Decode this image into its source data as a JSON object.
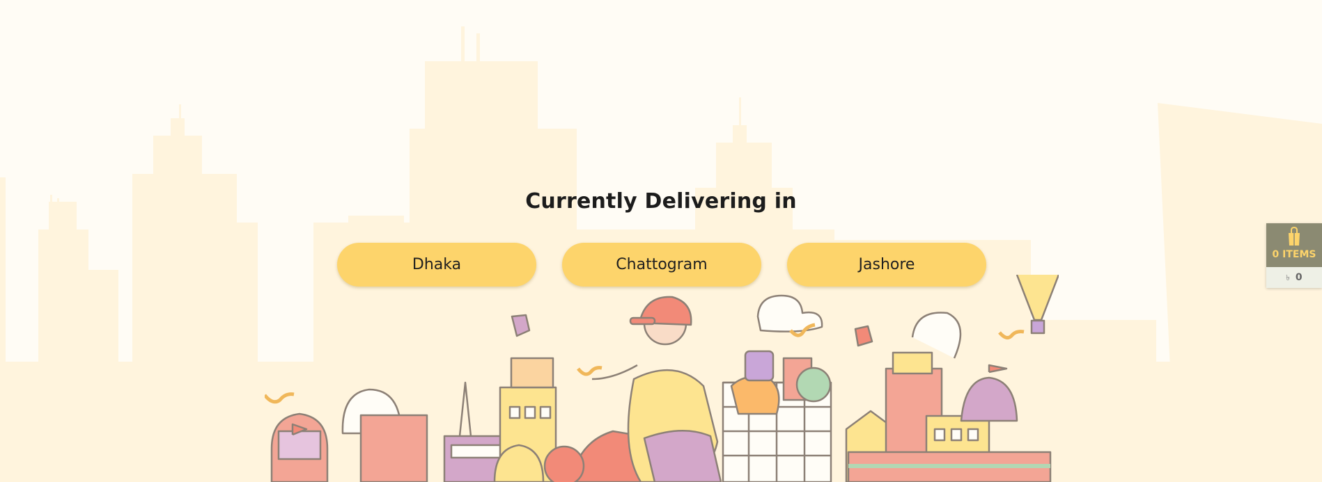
{
  "heading": "Currently Delivering in",
  "cities": [
    {
      "label": "Dhaka"
    },
    {
      "label": "Chattogram"
    },
    {
      "label": "Jashore"
    }
  ],
  "cart": {
    "items_label": "0 ITEMS",
    "currency": "৳",
    "amount": "0"
  },
  "colors": {
    "button": "#fdd46b",
    "skyline": "#fff4dd",
    "cart_top": "#8b8a72",
    "cart_bottom": "#eef0e6"
  },
  "icons": {
    "cart": "shopping-bag-icon"
  }
}
